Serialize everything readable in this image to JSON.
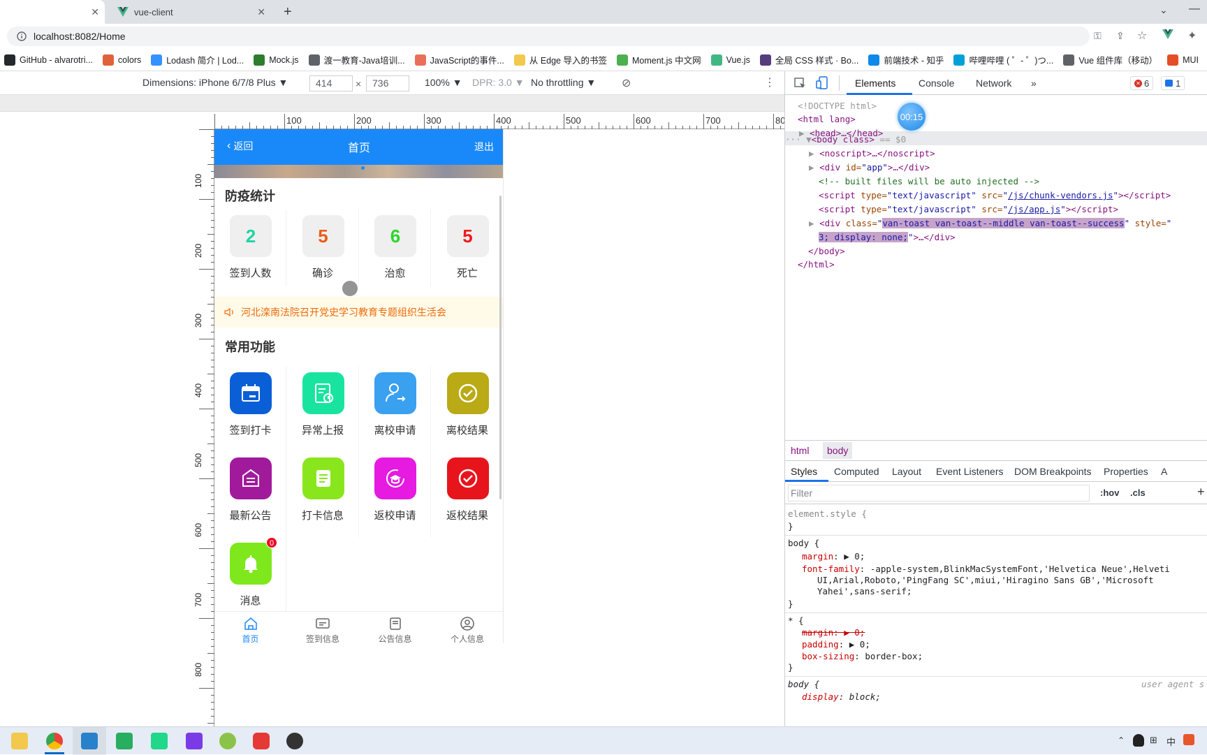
{
  "browser": {
    "tab_active_title": "vue-client",
    "url": "localhost:8082/Home",
    "bookmarks": [
      {
        "label": "GitHub - alvarotri...",
        "icon": "github-icon",
        "color": "#24292e"
      },
      {
        "label": "colors",
        "icon": "colors-icon",
        "color": "#e0623a"
      },
      {
        "label": "Lodash 简介 | Lod...",
        "icon": "lodash-icon",
        "color": "#3492ff"
      },
      {
        "label": "Mock.js",
        "icon": "mockjs-icon",
        "color": "#2c7d2c"
      },
      {
        "label": "渡一教育-Java培训...",
        "icon": "globe-icon",
        "color": "#5f6368"
      },
      {
        "label": "JavaScript的事件...",
        "icon": "jianshu-icon",
        "color": "#ea6f5a"
      },
      {
        "label": "从 Edge 导入的书签",
        "icon": "folder-icon",
        "color": "#f2c94c"
      },
      {
        "label": "Moment.js 中文网",
        "icon": "moment-icon",
        "color": "#4caf50"
      },
      {
        "label": "Vue.js",
        "icon": "vue-icon",
        "color": "#41b883"
      },
      {
        "label": "全局 CSS 样式 · Bo...",
        "icon": "bootstrap-icon",
        "color": "#563d7c"
      },
      {
        "label": "前端技术 - 知乎",
        "icon": "zhihu-icon",
        "color": "#0f88eb"
      },
      {
        "label": "哔哩哔哩 ( ゜- ゜)つ...",
        "icon": "bilibili-icon",
        "color": "#00a1d6"
      },
      {
        "label": "Vue 组件库（移动）",
        "icon": "globe-icon",
        "color": "#5f6368"
      },
      {
        "label": "MUI",
        "icon": "mui-icon",
        "color": "#e44d26"
      }
    ]
  },
  "device_toolbar": {
    "dimensions": "Dimensions: iPhone 6/7/8 Plus ▼",
    "width": "414",
    "height": "736",
    "zoom": "100% ▼",
    "dpr": "DPR: 3.0 ▼",
    "throttling": "No throttling ▼",
    "ruler_labels": [
      "100",
      "200",
      "300",
      "400",
      "500",
      "600",
      "700",
      "80"
    ],
    "vruler_labels": [
      "100",
      "200",
      "300",
      "400",
      "500",
      "600",
      "700",
      "800"
    ]
  },
  "app": {
    "nav": {
      "back": "返回",
      "title": "首页",
      "logout": "退出"
    },
    "stats_title": "防疫统计",
    "stats": [
      {
        "value": "2",
        "label": "签到人数",
        "color": "#1fd4a5"
      },
      {
        "value": "5",
        "label": "确诊",
        "color": "#e85d1a"
      },
      {
        "value": "6",
        "label": "治愈",
        "color": "#2bd62b"
      },
      {
        "value": "5",
        "label": "死亡",
        "color": "#ee1a1a"
      }
    ],
    "notice": "河北滦南法院召开党史学习教育专题组织生活会",
    "func_title": "常用功能",
    "functions": [
      {
        "label": "签到打卡",
        "color": "#0a5fd6",
        "icon": "calendar-icon"
      },
      {
        "label": "异常上报",
        "color": "#18e4a0",
        "icon": "report-icon"
      },
      {
        "label": "离校申请",
        "color": "#3aa0f0",
        "icon": "user-leave-icon"
      },
      {
        "label": "离校结果",
        "color": "#b9aa16",
        "icon": "check-circle-icon"
      },
      {
        "label": "最新公告",
        "color": "#a21a9c",
        "icon": "announcement-icon"
      },
      {
        "label": "打卡信息",
        "color": "#8ae61c",
        "icon": "document-icon"
      },
      {
        "label": "返校申请",
        "color": "#e61ae0",
        "icon": "graduation-icon"
      },
      {
        "label": "返校结果",
        "color": "#e8141c",
        "icon": "check-circle-icon"
      },
      {
        "label": "消息",
        "color": "#7ee81c",
        "icon": "bell-icon",
        "badge": "0"
      }
    ],
    "tabbar": [
      {
        "label": "首页",
        "icon": "home-icon",
        "active": true
      },
      {
        "label": "签到信息",
        "icon": "card-icon",
        "active": false
      },
      {
        "label": "公告信息",
        "icon": "notice-icon",
        "active": false
      },
      {
        "label": "个人信息",
        "icon": "user-icon",
        "active": false
      }
    ]
  },
  "devtools": {
    "tabs": [
      "Elements",
      "Console",
      "Network",
      "»"
    ],
    "error_count": "6",
    "message_count": "1",
    "timer": "00:15",
    "dom": {
      "doctype": "<!DOCTYPE html>",
      "html_open": "<html lang>",
      "head": "<head>…</head>",
      "body": "<body class>",
      "body_suffix": "== $0",
      "noscript": "<noscript>…</noscript>",
      "div_app_tag": "<div ",
      "div_app_attr": "id=",
      "div_app_val": "\"app\"",
      "div_app_end": ">…</div>",
      "comment": "<!-- built files will be auto injected -->",
      "script1_link": "/js/chunk-vendors.js",
      "script2_link": "/js/app.js",
      "script_type": "\"text/javascript\"",
      "toast_class": "van-toast van-toast--middle van-toast--success",
      "toast_style_end": "3; display: none;",
      "body_close": "</body>",
      "html_close": "</html>"
    },
    "crumbs": [
      "html",
      "body"
    ],
    "style_tabs": [
      "Styles",
      "Computed",
      "Layout",
      "Event Listeners",
      "DOM Breakpoints",
      "Properties",
      "A"
    ],
    "filter_placeholder": "Filter",
    "hov": ":hov",
    "cls": ".cls",
    "styles": {
      "element_style": "element.style {",
      "close": "}",
      "body_sel": "body {",
      "margin_prop": "margin",
      "margin_val": "▶ 0;",
      "font_prop": "font-family",
      "font_val_1": "-apple-system,BlinkMacSystemFont,'Helvetica Neue',Helveti",
      "font_val_2": "UI,Arial,Roboto,'PingFang SC',miui,'Hiragino Sans GB','Microsoft",
      "font_val_3": "Yahei',sans-serif;",
      "star_sel": "* {",
      "margin_struck": "margin: ▶ 0;",
      "padding_prop": "padding",
      "padding_val": "▶ 0;",
      "boxsizing_prop": "box-sizing",
      "boxsizing_val": "border-box;",
      "body_ua": "body {",
      "ua_label": "user agent s",
      "display_prop": "display",
      "display_val": "block;"
    }
  }
}
